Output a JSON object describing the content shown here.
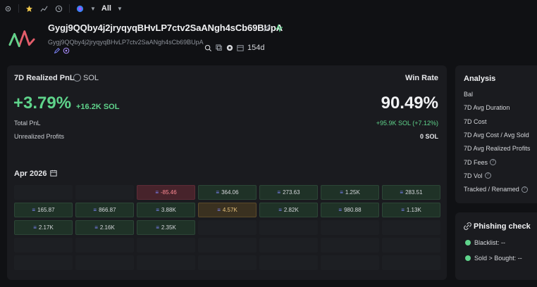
{
  "topbar": {
    "filter_label": "All",
    "icons": [
      "settings-icon",
      "star-icon",
      "chart-icon",
      "history-icon",
      "globe-icon"
    ]
  },
  "wallet": {
    "name": "Gygj9QQby4j2jryqyqBHvLP7ctv2SaANgh4sCb69BUpA",
    "address": "Gygj9QQby4j2jryqyqBHvLP7ctv2SaANgh4sCb69BUpA",
    "age": "154d"
  },
  "pnl": {
    "title": "7D Realized PnL",
    "currency": "SOL",
    "percent": "+3.79%",
    "sol": "+16.2K SOL",
    "total_label": "Total PnL",
    "unrealized_label": "Unrealized Profits",
    "unrealized_value": "0 SOL",
    "winrate_title": "Win Rate",
    "winrate_value": "90.49%",
    "winrate_sub": "+95.9K SOL (+7.12%)"
  },
  "calendar": {
    "month": "Apr 2026",
    "cells": [
      {
        "v": "",
        "t": "empty"
      },
      {
        "v": "",
        "t": "empty"
      },
      {
        "v": "-85.46",
        "t": "neg"
      },
      {
        "v": "364.06",
        "t": "pos"
      },
      {
        "v": "273.63",
        "t": "pos"
      },
      {
        "v": "1.25K",
        "t": "pos"
      },
      {
        "v": "283.51",
        "t": "pos"
      },
      {
        "v": "165.87",
        "t": "pos"
      },
      {
        "v": "866.87",
        "t": "pos"
      },
      {
        "v": "3.88K",
        "t": "pos"
      },
      {
        "v": "4.57K",
        "t": "hl"
      },
      {
        "v": "2.82K",
        "t": "pos"
      },
      {
        "v": "980.88",
        "t": "pos"
      },
      {
        "v": "1.13K",
        "t": "pos"
      },
      {
        "v": "2.17K",
        "t": "pos"
      },
      {
        "v": "2.16K",
        "t": "pos"
      },
      {
        "v": "2.35K",
        "t": "pos"
      },
      {
        "v": "",
        "t": "empty"
      },
      {
        "v": "",
        "t": "empty"
      },
      {
        "v": "",
        "t": "empty"
      },
      {
        "v": "",
        "t": "empty"
      },
      {
        "v": "",
        "t": "empty"
      },
      {
        "v": "",
        "t": "empty"
      },
      {
        "v": "",
        "t": "empty"
      },
      {
        "v": "",
        "t": "empty"
      },
      {
        "v": "",
        "t": "empty"
      },
      {
        "v": "",
        "t": "empty"
      },
      {
        "v": "",
        "t": "empty"
      },
      {
        "v": "",
        "t": "empty"
      },
      {
        "v": "",
        "t": "empty"
      },
      {
        "v": "",
        "t": "empty"
      },
      {
        "v": "",
        "t": "empty"
      },
      {
        "v": "",
        "t": "empty"
      },
      {
        "v": "",
        "t": "empty"
      },
      {
        "v": "",
        "t": "empty"
      }
    ]
  },
  "analysis": {
    "title": "Analysis",
    "items": [
      {
        "label": "Bal",
        "help": false
      },
      {
        "label": "7D Avg Duration",
        "help": false
      },
      {
        "label": "7D Cost",
        "help": false
      },
      {
        "label": "7D Avg Cost / Avg Sold",
        "help": false
      },
      {
        "label": "7D Avg Realized Profits",
        "help": false
      },
      {
        "label": "7D Fees",
        "help": true
      },
      {
        "label": "7D Vol",
        "help": true
      },
      {
        "label": "Tracked / Renamed",
        "help": true
      }
    ]
  },
  "phishing": {
    "title": "Phishing check",
    "blacklist": "Blacklist: --",
    "sold_bought": "Sold > Bought: --"
  },
  "colors": {
    "green": "#5fd48b",
    "red": "#ff8a94",
    "panel": "#1a1b1f",
    "bg": "#101114"
  }
}
